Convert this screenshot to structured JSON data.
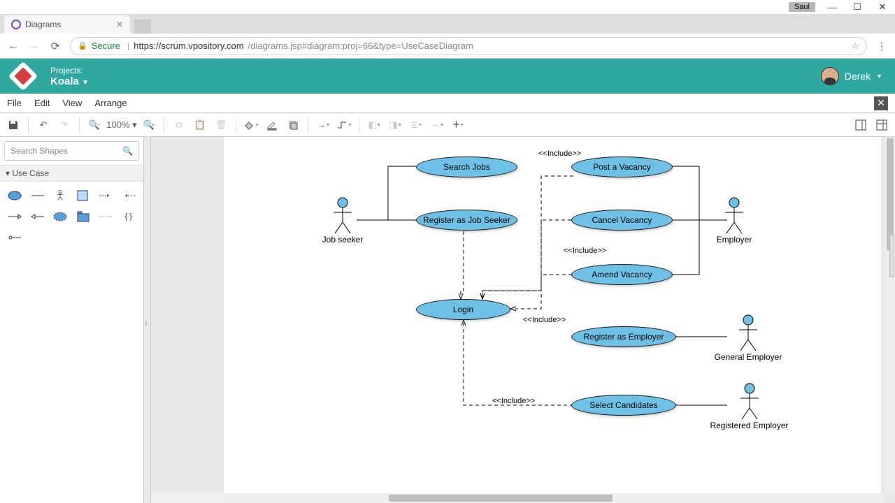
{
  "os": {
    "user": "Saul"
  },
  "browser": {
    "tab_title": "Diagrams",
    "secure_label": "Secure",
    "url_host": "https://scrum.vpository.com",
    "url_path": "/diagrams.jsp#diagram:proj=66&type=UseCaseDiagram"
  },
  "header": {
    "projects_label": "Projects:",
    "project_name": "Koala",
    "user_name": "Derek"
  },
  "menu": {
    "file": "File",
    "edit": "Edit",
    "view": "View",
    "arrange": "Arrange"
  },
  "toolbar": {
    "zoom": "100%"
  },
  "sidebar": {
    "search_placeholder": "Search Shapes",
    "palette_title": "Use Case"
  },
  "diagram": {
    "actors": {
      "job_seeker": "Job seeker",
      "employer": "Employer",
      "general_employer": "General Employer",
      "registered_employer": "Registered Employer"
    },
    "usecases": {
      "search_jobs": "Search Jobs",
      "register_job_seeker": "Register as Job Seeker",
      "post_vacancy": "Post a Vacancy",
      "cancel_vacancy": "Cancel Vacancy",
      "amend_vacancy": "Amend Vacancy",
      "login": "Login",
      "register_employer": "Register as Employer",
      "select_candidates": "Select Candidates"
    },
    "include_label": "<<Include>>"
  },
  "chart_data": {
    "type": "uml_use_case_diagram",
    "actors": [
      "Job seeker",
      "Employer",
      "General Employer",
      "Registered Employer"
    ],
    "use_cases": [
      "Search Jobs",
      "Register as Job Seeker",
      "Post a Vacancy",
      "Cancel Vacancy",
      "Amend Vacancy",
      "Login",
      "Register as Employer",
      "Select Candidates"
    ],
    "associations": [
      [
        "Job seeker",
        "Search Jobs"
      ],
      [
        "Job seeker",
        "Register as Job Seeker"
      ],
      [
        "Employer",
        "Post a Vacancy"
      ],
      [
        "Employer",
        "Cancel Vacancy"
      ],
      [
        "Employer",
        "Amend Vacancy"
      ],
      [
        "General Employer",
        "Register as Employer"
      ],
      [
        "Registered Employer",
        "Select Candidates"
      ]
    ],
    "includes": [
      [
        "Register as Job Seeker",
        "Login"
      ],
      [
        "Post a Vacancy",
        "Login"
      ],
      [
        "Cancel Vacancy",
        "Login"
      ],
      [
        "Amend Vacancy",
        "Login"
      ],
      [
        "Select Candidates",
        "Login"
      ]
    ]
  }
}
